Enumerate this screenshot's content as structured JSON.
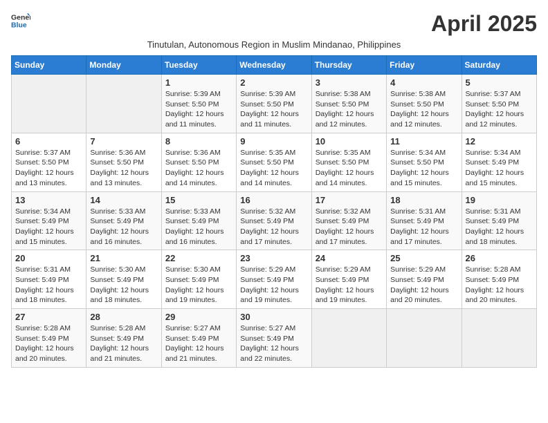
{
  "header": {
    "logo_general": "General",
    "logo_blue": "Blue",
    "title": "April 2025",
    "subtitle": "Tinutulan, Autonomous Region in Muslim Mindanao, Philippines"
  },
  "weekdays": [
    "Sunday",
    "Monday",
    "Tuesday",
    "Wednesday",
    "Thursday",
    "Friday",
    "Saturday"
  ],
  "weeks": [
    [
      {
        "day": "",
        "info": ""
      },
      {
        "day": "",
        "info": ""
      },
      {
        "day": "1",
        "info": "Sunrise: 5:39 AM\nSunset: 5:50 PM\nDaylight: 12 hours and 11 minutes."
      },
      {
        "day": "2",
        "info": "Sunrise: 5:39 AM\nSunset: 5:50 PM\nDaylight: 12 hours and 11 minutes."
      },
      {
        "day": "3",
        "info": "Sunrise: 5:38 AM\nSunset: 5:50 PM\nDaylight: 12 hours and 12 minutes."
      },
      {
        "day": "4",
        "info": "Sunrise: 5:38 AM\nSunset: 5:50 PM\nDaylight: 12 hours and 12 minutes."
      },
      {
        "day": "5",
        "info": "Sunrise: 5:37 AM\nSunset: 5:50 PM\nDaylight: 12 hours and 12 minutes."
      }
    ],
    [
      {
        "day": "6",
        "info": "Sunrise: 5:37 AM\nSunset: 5:50 PM\nDaylight: 12 hours and 13 minutes."
      },
      {
        "day": "7",
        "info": "Sunrise: 5:36 AM\nSunset: 5:50 PM\nDaylight: 12 hours and 13 minutes."
      },
      {
        "day": "8",
        "info": "Sunrise: 5:36 AM\nSunset: 5:50 PM\nDaylight: 12 hours and 14 minutes."
      },
      {
        "day": "9",
        "info": "Sunrise: 5:35 AM\nSunset: 5:50 PM\nDaylight: 12 hours and 14 minutes."
      },
      {
        "day": "10",
        "info": "Sunrise: 5:35 AM\nSunset: 5:50 PM\nDaylight: 12 hours and 14 minutes."
      },
      {
        "day": "11",
        "info": "Sunrise: 5:34 AM\nSunset: 5:50 PM\nDaylight: 12 hours and 15 minutes."
      },
      {
        "day": "12",
        "info": "Sunrise: 5:34 AM\nSunset: 5:49 PM\nDaylight: 12 hours and 15 minutes."
      }
    ],
    [
      {
        "day": "13",
        "info": "Sunrise: 5:34 AM\nSunset: 5:49 PM\nDaylight: 12 hours and 15 minutes."
      },
      {
        "day": "14",
        "info": "Sunrise: 5:33 AM\nSunset: 5:49 PM\nDaylight: 12 hours and 16 minutes."
      },
      {
        "day": "15",
        "info": "Sunrise: 5:33 AM\nSunset: 5:49 PM\nDaylight: 12 hours and 16 minutes."
      },
      {
        "day": "16",
        "info": "Sunrise: 5:32 AM\nSunset: 5:49 PM\nDaylight: 12 hours and 17 minutes."
      },
      {
        "day": "17",
        "info": "Sunrise: 5:32 AM\nSunset: 5:49 PM\nDaylight: 12 hours and 17 minutes."
      },
      {
        "day": "18",
        "info": "Sunrise: 5:31 AM\nSunset: 5:49 PM\nDaylight: 12 hours and 17 minutes."
      },
      {
        "day": "19",
        "info": "Sunrise: 5:31 AM\nSunset: 5:49 PM\nDaylight: 12 hours and 18 minutes."
      }
    ],
    [
      {
        "day": "20",
        "info": "Sunrise: 5:31 AM\nSunset: 5:49 PM\nDaylight: 12 hours and 18 minutes."
      },
      {
        "day": "21",
        "info": "Sunrise: 5:30 AM\nSunset: 5:49 PM\nDaylight: 12 hours and 18 minutes."
      },
      {
        "day": "22",
        "info": "Sunrise: 5:30 AM\nSunset: 5:49 PM\nDaylight: 12 hours and 19 minutes."
      },
      {
        "day": "23",
        "info": "Sunrise: 5:29 AM\nSunset: 5:49 PM\nDaylight: 12 hours and 19 minutes."
      },
      {
        "day": "24",
        "info": "Sunrise: 5:29 AM\nSunset: 5:49 PM\nDaylight: 12 hours and 19 minutes."
      },
      {
        "day": "25",
        "info": "Sunrise: 5:29 AM\nSunset: 5:49 PM\nDaylight: 12 hours and 20 minutes."
      },
      {
        "day": "26",
        "info": "Sunrise: 5:28 AM\nSunset: 5:49 PM\nDaylight: 12 hours and 20 minutes."
      }
    ],
    [
      {
        "day": "27",
        "info": "Sunrise: 5:28 AM\nSunset: 5:49 PM\nDaylight: 12 hours and 20 minutes."
      },
      {
        "day": "28",
        "info": "Sunrise: 5:28 AM\nSunset: 5:49 PM\nDaylight: 12 hours and 21 minutes."
      },
      {
        "day": "29",
        "info": "Sunrise: 5:27 AM\nSunset: 5:49 PM\nDaylight: 12 hours and 21 minutes."
      },
      {
        "day": "30",
        "info": "Sunrise: 5:27 AM\nSunset: 5:49 PM\nDaylight: 12 hours and 22 minutes."
      },
      {
        "day": "",
        "info": ""
      },
      {
        "day": "",
        "info": ""
      },
      {
        "day": "",
        "info": ""
      }
    ]
  ]
}
